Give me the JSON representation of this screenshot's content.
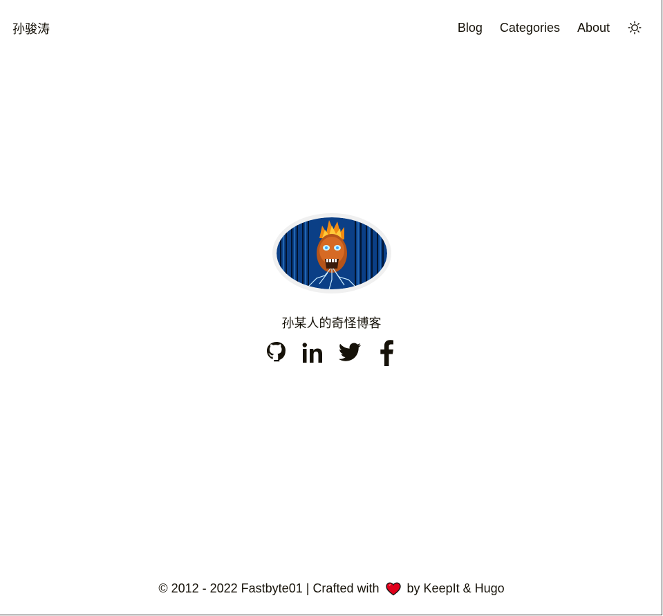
{
  "header": {
    "logo": "孙骏涛",
    "nav": [
      {
        "label": "Blog"
      },
      {
        "label": "Categories"
      },
      {
        "label": "About"
      }
    ],
    "theme_toggle_icon": "sun-icon"
  },
  "home": {
    "avatar_icon": "avatar-skull-matrix",
    "subtitle": "孙某人的奇怪博客",
    "social": [
      {
        "icon": "github-icon"
      },
      {
        "icon": "linkedin-icon"
      },
      {
        "icon": "twitter-icon"
      },
      {
        "icon": "facebook-icon"
      }
    ]
  },
  "footer": {
    "copyright": "© 2012 - 2022 Fastbyte01",
    "separator": "|",
    "crafted": "Crafted with",
    "heart_icon": "heart-icon",
    "by": "by",
    "theme_link": "KeepIt",
    "amp": "&",
    "engine_link": "Hugo"
  },
  "colors": {
    "text": "#161209",
    "heart": "#e0001b",
    "avatar_ring": "#f0f0f0",
    "avatar_bg": "#0b3f86"
  }
}
